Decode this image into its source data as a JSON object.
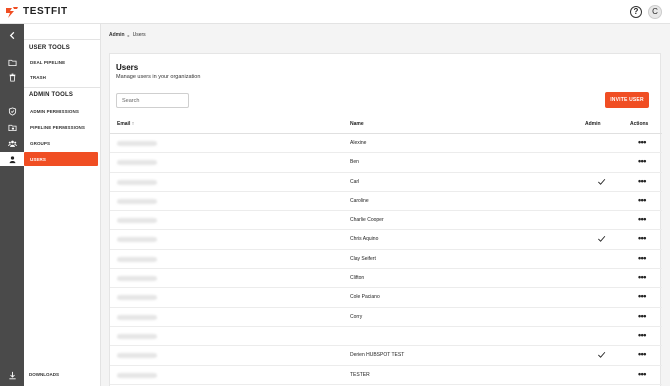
{
  "app": {
    "title": "TESTFIT",
    "user_initial": "C",
    "help_glyph": "?"
  },
  "sidebar": {
    "user_tools_heading": "USER TOOLS",
    "user_tools": [
      {
        "label": "DEAL PIPELINE",
        "icon": "folder-icon"
      },
      {
        "label": "TRASH",
        "icon": "trash-icon"
      }
    ],
    "admin_tools_heading": "ADMIN TOOLS",
    "admin_tools": [
      {
        "label": "ADMIN PERMISSIONS",
        "icon": "shield-icon"
      },
      {
        "label": "PIPELINE PERMISSIONS",
        "icon": "folder-lock-icon"
      },
      {
        "label": "GROUPS",
        "icon": "group-icon"
      },
      {
        "label": "USERS",
        "icon": "user-icon",
        "active": true
      }
    ],
    "downloads_label": "DOWNLOADS"
  },
  "breadcrumb": {
    "root": "Admin",
    "separator": "▸",
    "current": "Users"
  },
  "page": {
    "title": "Users",
    "subtitle": "Manage users in your organization",
    "search_placeholder": "Search",
    "invite_label": "INVITE USER"
  },
  "table": {
    "columns": {
      "email": "Email",
      "email_sort": "↑",
      "name": "Name",
      "admin": "Admin",
      "actions": "Actions"
    },
    "rows": [
      {
        "name": "Alexine",
        "admin": false
      },
      {
        "name": "Ben",
        "admin": false
      },
      {
        "name": "Carl",
        "admin": true
      },
      {
        "name": "Caroline",
        "admin": false
      },
      {
        "name": "Charlie Cooper",
        "admin": false
      },
      {
        "name": "Chris Aquino",
        "admin": true
      },
      {
        "name": "Clay Seifert",
        "admin": false
      },
      {
        "name": "Clifton",
        "admin": false
      },
      {
        "name": "Cole Paciano",
        "admin": false
      },
      {
        "name": "Corry",
        "admin": false
      },
      {
        "name": "",
        "admin": false
      },
      {
        "name": "Derien HUBSPOT TEST",
        "admin": true
      },
      {
        "name": "TESTER",
        "admin": false
      }
    ],
    "actions_glyph": "•••"
  },
  "colors": {
    "accent": "#f04e23",
    "rail": "#4a4a4a",
    "main_bg": "#f4f4f4"
  }
}
